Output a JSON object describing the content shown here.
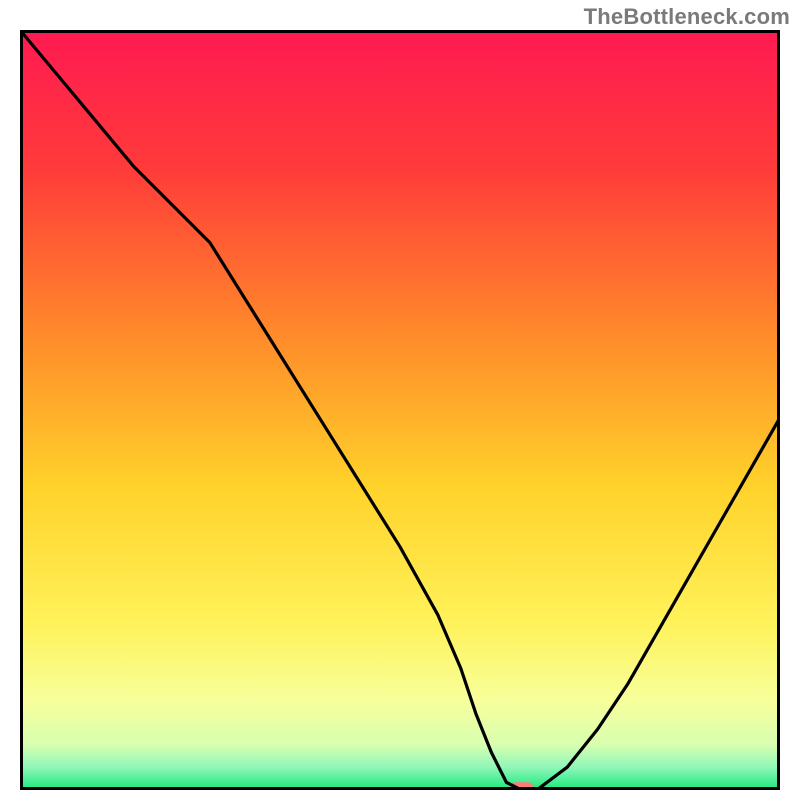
{
  "watermark": "TheBottleneck.com",
  "chart_data": {
    "type": "line",
    "title": "",
    "xlabel": "",
    "ylabel": "",
    "xlim": [
      0,
      100
    ],
    "ylim": [
      0,
      100
    ],
    "x": [
      0,
      5,
      10,
      15,
      20,
      25,
      30,
      35,
      40,
      45,
      50,
      55,
      58,
      60,
      62,
      64,
      66,
      68,
      72,
      76,
      80,
      84,
      88,
      92,
      96,
      100
    ],
    "values": [
      100,
      94,
      88,
      82,
      77,
      72,
      64,
      56,
      48,
      40,
      32,
      23,
      16,
      10,
      5,
      1,
      0,
      0,
      3,
      8,
      14,
      21,
      28,
      35,
      42,
      49
    ],
    "gradient_stops": [
      {
        "offset": 0,
        "color": "#ff1a52"
      },
      {
        "offset": 18,
        "color": "#ff3a3a"
      },
      {
        "offset": 40,
        "color": "#ff8a2a"
      },
      {
        "offset": 60,
        "color": "#ffd22a"
      },
      {
        "offset": 78,
        "color": "#fff25a"
      },
      {
        "offset": 88,
        "color": "#f8ff9a"
      },
      {
        "offset": 94,
        "color": "#d8ffb0"
      },
      {
        "offset": 97,
        "color": "#90f7b8"
      },
      {
        "offset": 100,
        "color": "#18e87a"
      }
    ],
    "marker": {
      "x": 66,
      "y": 0,
      "width_pct": 3.0,
      "height_pct": 1.2,
      "color": "#ff7a7a"
    },
    "frame_color": "#000000",
    "line_color": "#000000"
  }
}
